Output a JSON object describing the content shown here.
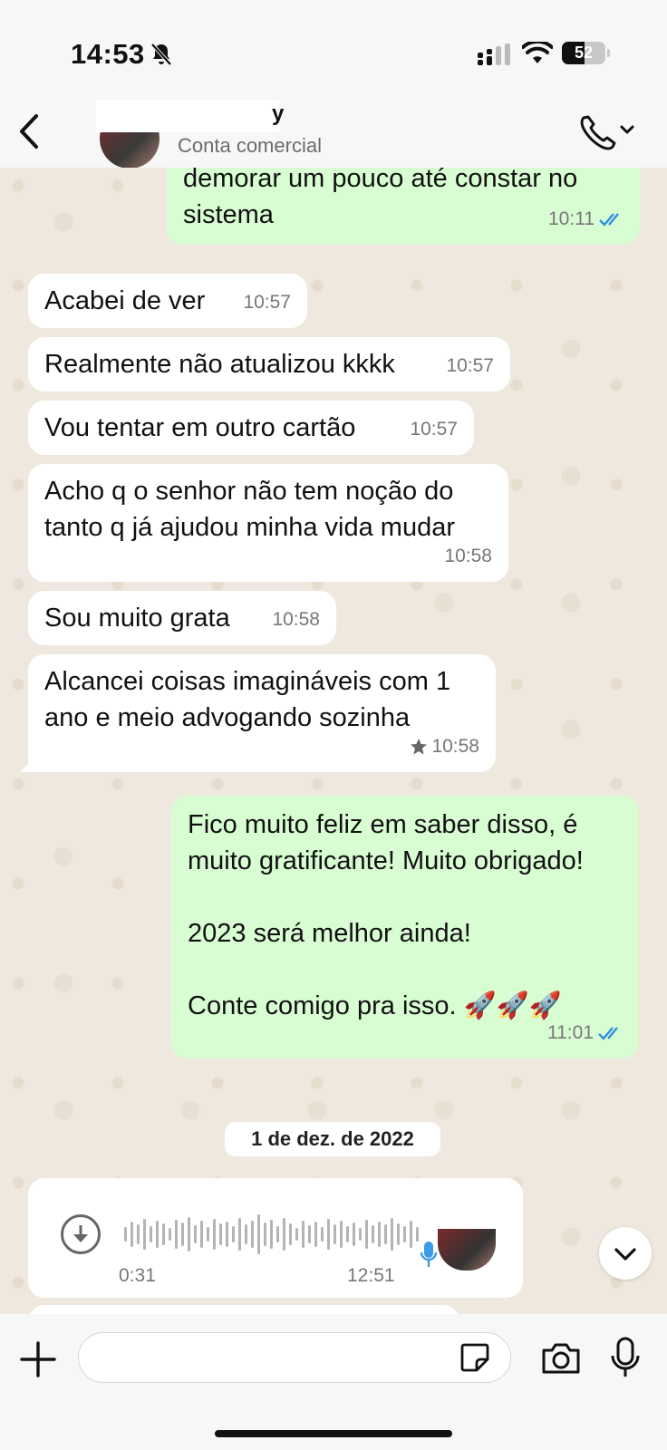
{
  "status_bar": {
    "time": "14:53",
    "battery": "52",
    "icons": [
      "bell-slash-icon",
      "cellular-signal-icon",
      "wifi-icon",
      "battery-icon"
    ]
  },
  "header": {
    "contact_name_tail": "y",
    "contact_subtitle": "Conta comercial",
    "icons": [
      "back-chevron-icon",
      "phone-icon",
      "chevron-down-icon"
    ]
  },
  "messages": [
    {
      "direction": "out",
      "text": "demorar um pouco até constar no\nsistema",
      "time": "10:11",
      "read": true
    },
    {
      "direction": "in",
      "text": "Acabei de ver",
      "time": "10:57"
    },
    {
      "direction": "in",
      "text": "Realmente não atualizou kkkk",
      "time": "10:57"
    },
    {
      "direction": "in",
      "text": "Vou tentar em outro cartão",
      "time": "10:57"
    },
    {
      "direction": "in",
      "text": "Acho q o senhor não tem noção do\ntanto q já ajudou minha vida mudar",
      "time": "10:58"
    },
    {
      "direction": "in",
      "text": "Sou muito grata",
      "time": "10:58"
    },
    {
      "direction": "in",
      "text": "Alcancei coisas imagináveis com 1\nano e meio advogando sozinha",
      "time": "10:58",
      "starred": true
    },
    {
      "direction": "out",
      "text": "Fico muito feliz em saber disso, é\nmuito gratificante! Muito obrigado!\n\n2023 será melhor ainda!\n\nConte comigo pra isso. 🚀🚀🚀",
      "time": "11:01",
      "read": true
    }
  ],
  "date_separator": "1 de dez. de 2022",
  "voice_message": {
    "duration": "0:31",
    "time": "12:51",
    "icons": [
      "download-icon",
      "microphone-icon"
    ]
  },
  "composer": {
    "input_value": "",
    "icons": [
      "plus-icon",
      "sticker-icon",
      "camera-icon",
      "microphone-icon"
    ]
  },
  "colors": {
    "outgoing_bubble": "#d9fdd3",
    "incoming_bubble": "#ffffff",
    "read_check": "#2e8fe0",
    "chat_background": "#efe8de"
  }
}
